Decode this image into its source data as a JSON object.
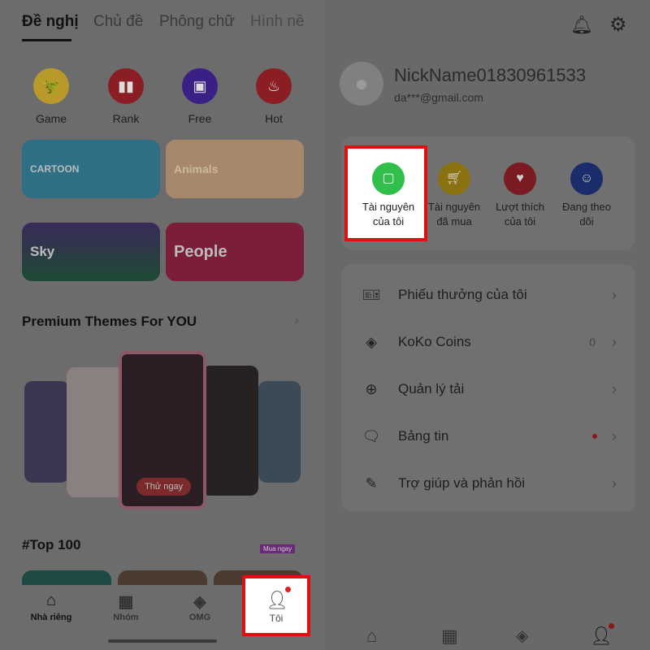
{
  "left": {
    "tabs": [
      {
        "label": "Đề nghị",
        "active": true
      },
      {
        "label": "Chủ đề"
      },
      {
        "label": "Phông chữ"
      },
      {
        "label": "Hình nề"
      }
    ],
    "categories": [
      {
        "label": "Game",
        "icon": "dinosaur-icon",
        "color": "#b89a2a"
      },
      {
        "label": "Rank",
        "icon": "bar-chart-icon",
        "color": "#8a1e24"
      },
      {
        "label": "Free",
        "icon": "gift-icon",
        "color": "#3a1f85"
      },
      {
        "label": "Hot",
        "icon": "flame-icon",
        "color": "#8a1e24"
      }
    ],
    "banners": [
      {
        "label": "CARTOON",
        "color": "#2f6f86"
      },
      {
        "label": "Animals",
        "color": "#a8886a"
      },
      {
        "label": "Sky",
        "color": "#2a4a3a"
      },
      {
        "label": "People",
        "color": "#7a1e3a"
      }
    ],
    "premium_title": "Premium Themes For YOU",
    "try_now": "Thử ngay",
    "buy_now": "Mua ngay",
    "top100": "#Top 100",
    "nav": [
      {
        "label": "Nhà riêng",
        "icon": "home-icon",
        "active": true
      },
      {
        "label": "Nhóm",
        "icon": "grid-icon"
      },
      {
        "label": "OMG",
        "icon": "brush-icon"
      },
      {
        "label": "Tôi",
        "icon": "person-icon",
        "badge": true
      }
    ]
  },
  "right": {
    "nickname": "NickName01830961533",
    "email": "da***@gmail.com",
    "actions": [
      {
        "label1": "Tài nguyên",
        "label2": "của tôi",
        "icon": "bag-icon",
        "color": "#2fbf4a"
      },
      {
        "label1": "Tài nguyên",
        "label2": "đã mua",
        "icon": "cart-icon",
        "color": "#8a7210"
      },
      {
        "label1": "Lượt thích",
        "label2": "của tôi",
        "icon": "heart-icon",
        "color": "#7a1a22"
      },
      {
        "label1": "Đang theo",
        "label2": "dõi",
        "icon": "follow-icon",
        "color": "#1a2c6a"
      }
    ],
    "menu": [
      {
        "label": "Phiếu thưởng của tôi",
        "icon": "ticket-icon"
      },
      {
        "label": "KoKo Coins",
        "icon": "coin-icon",
        "value": "0"
      },
      {
        "label": "Quản lý tải",
        "icon": "download-icon"
      },
      {
        "label": "Bảng tin",
        "icon": "message-icon",
        "badge": true
      },
      {
        "label": "Trợ giúp và phản hồi",
        "icon": "feedback-icon"
      }
    ],
    "nav_icons": [
      "home-icon",
      "grid-icon",
      "brush-icon",
      "person-icon"
    ]
  },
  "colors": {
    "highlight": "#e01010",
    "badge": "#e02020"
  }
}
